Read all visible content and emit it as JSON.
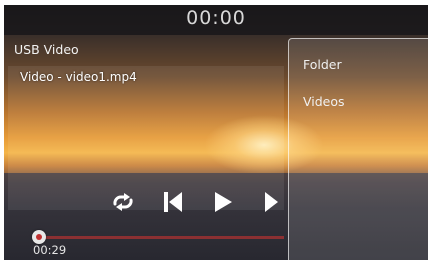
{
  "header": {
    "clock": "00:00"
  },
  "player": {
    "source_title": "USB Video",
    "now_playing": "Video - video1.mp4",
    "elapsed": "00:29",
    "progress_fraction": 0.02,
    "controls": [
      {
        "name": "repeat-icon"
      },
      {
        "name": "previous-track-icon"
      },
      {
        "name": "play-icon"
      },
      {
        "name": "next-track-icon"
      }
    ]
  },
  "sidebar": {
    "items": [
      {
        "label": "Folder"
      },
      {
        "label": "Videos"
      }
    ]
  },
  "colors": {
    "progress_track": "#b43232",
    "progress_knob": "#e8e8e8",
    "text": "#f0f0f0"
  }
}
